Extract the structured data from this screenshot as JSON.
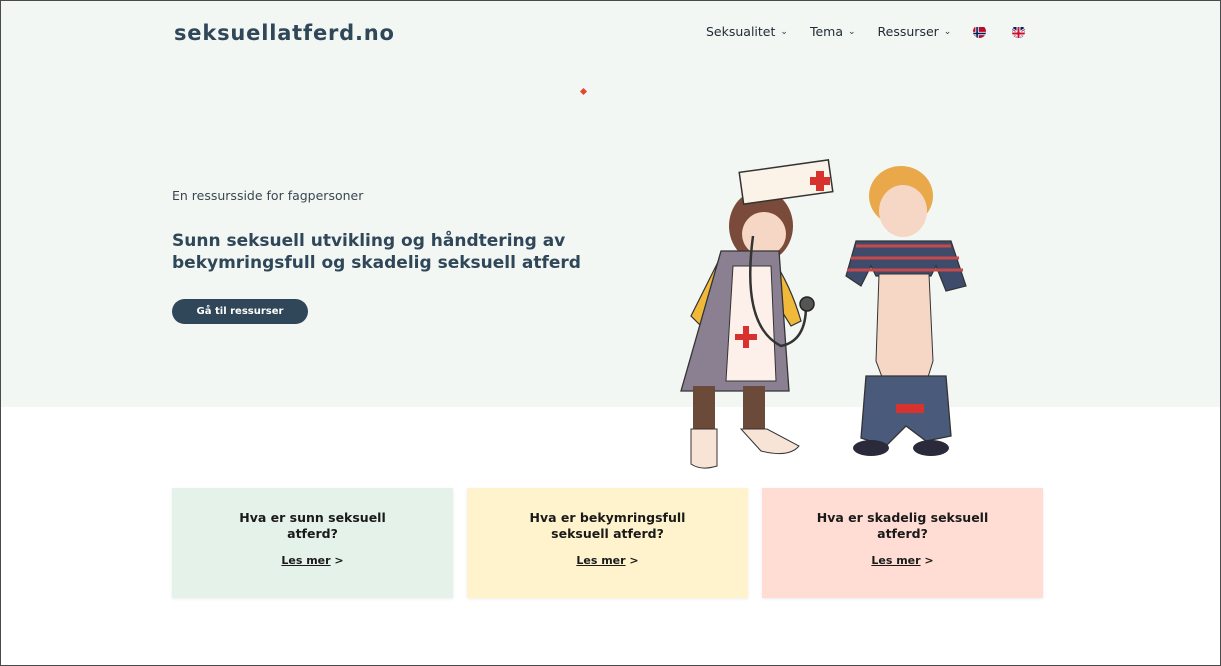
{
  "header": {
    "logo": "seksuellatferd.no",
    "nav": [
      {
        "label": "Seksualitet",
        "chevron": "⌄"
      },
      {
        "label": "Tema",
        "chevron": "⌄"
      },
      {
        "label": "Ressurser",
        "chevron": "⌄"
      }
    ],
    "languages": [
      "norwegian-flag-icon",
      "uk-flag-icon"
    ]
  },
  "hero": {
    "tagline": "En ressursside for fagpersoner",
    "headline": "Sunn seksuell utvikling og håndtering av bekymringsfull og skadelig seksuell atferd",
    "cta_label": "Gå til ressurser"
  },
  "cards": [
    {
      "title": "Hva er sunn seksuell atferd?",
      "link_label": "Les mer",
      "link_suffix": ">",
      "color": "#e5f2e9"
    },
    {
      "title": "Hva er bekymringsfull seksuell atferd?",
      "link_label": "Les mer",
      "link_suffix": ">",
      "color": "#fff3cd"
    },
    {
      "title": "Hva er skadelig seksuell atferd?",
      "link_label": "Les mer",
      "link_suffix": ">",
      "color": "#ffddd4"
    }
  ],
  "colors": {
    "brand": "#2f4758",
    "hero_bg": "#f3f7f4"
  }
}
